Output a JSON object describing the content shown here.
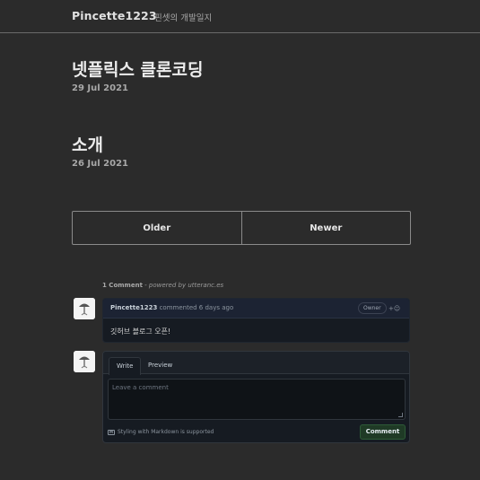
{
  "header": {
    "title": "Pincette1223",
    "subtitle": "핀셋의 개발일지"
  },
  "posts": [
    {
      "title": "넷플릭스 클론코딩",
      "date": "29 Jul 2021"
    },
    {
      "title": "소개",
      "date": "26 Jul 2021"
    }
  ],
  "pager": {
    "older": "Older",
    "newer": "Newer"
  },
  "comments_meta": {
    "count": "1 Comment",
    "powered": " - powered by utteranc.es"
  },
  "comment": {
    "author": "Pincette1223",
    "action": " commented 6 days ago",
    "badge": "Owner",
    "reaction_icon": "smiley-icon",
    "body": "깃허브 블로그 오픈!"
  },
  "editor": {
    "tab_write": "Write",
    "tab_preview": "Preview",
    "placeholder": "Leave a comment",
    "markdown_note": "Styling with Markdown is supported",
    "submit": "Comment"
  },
  "colors": {
    "background": "#2b2b2b",
    "comment_button": "#1f3a26"
  }
}
